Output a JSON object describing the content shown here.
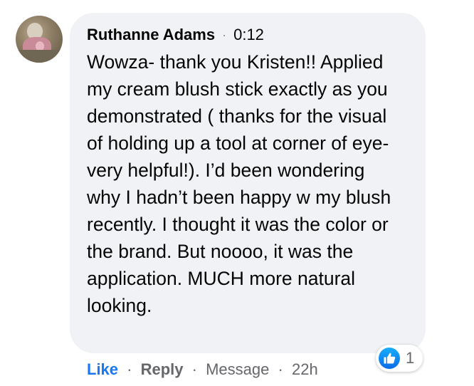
{
  "comment": {
    "author": "Ruthanne Adams",
    "separator": "·",
    "time": "0:12",
    "text": "Wowza- thank you Kristen!! Applied my cream blush stick exactly as you demonstrated ( thanks for the visual of holding up a tool at corner of eye- very helpful!). I’d been wondering why I hadn’t been happy w my blush recently. I thought it was the color or the brand. But noooo, it was the application. MUCH more natural looking."
  },
  "actions": {
    "like_label": "Like",
    "reply_label": "Reply",
    "message_label": "Message",
    "age": "22h",
    "dot": "·"
  },
  "reactions": {
    "icon": "like-thumbs-up-icon",
    "count": "1",
    "color": "#1877f2"
  },
  "colors": {
    "bubble_bg": "#f0f2f5",
    "link_blue": "#1877f2",
    "meta_gray": "#65676b"
  }
}
